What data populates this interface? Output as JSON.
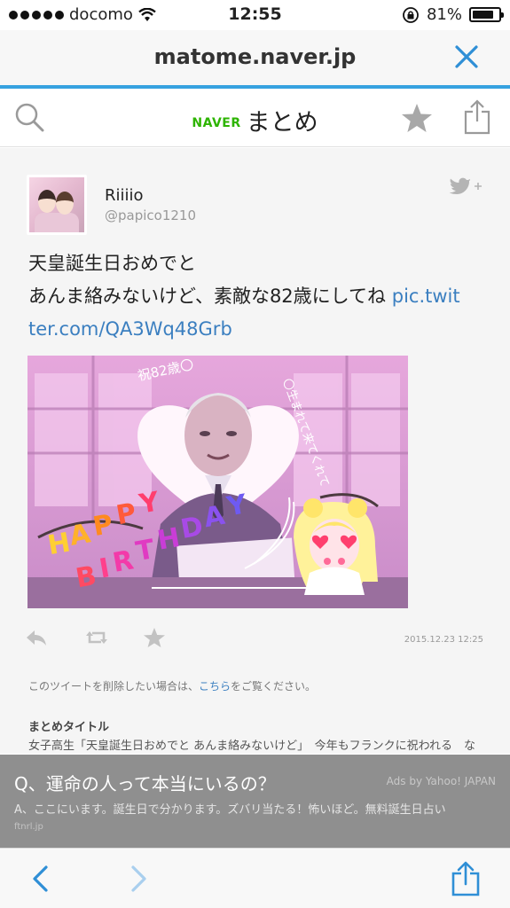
{
  "status_bar": {
    "carrier": "docomo",
    "time": "12:55",
    "battery": "81%",
    "battery_level": 0.81
  },
  "url_bar": {
    "domain": "matome.naver.jp"
  },
  "site_header": {
    "brand": "NAVER",
    "name": "まとめ"
  },
  "tweet": {
    "username": "Riiiio",
    "handle": "@papico1210",
    "line1": "天皇誕生日おめでと",
    "line2": "あんま絡みないけど、素敵な82歳にしてね",
    "link_part1": "pic.twit",
    "link_part2": "ter.com/QA3Wq48Grb",
    "photo_text": "HAPPY BIRTHDAY",
    "timestamp": "2015.12.23 12:25"
  },
  "delete_note": {
    "before": "このツイートを削除したい場合は、",
    "link": "こちら",
    "after": "をご覧ください。"
  },
  "matome": {
    "title_label": "まとめタイトル",
    "title_text": "女子高生「天皇誕生日おめでと あんま絡みないけど」　今年もフランクに祝われる　な"
  },
  "ad": {
    "question": "Q、運命の人って本当にいるの？",
    "by": "Ads by Yahoo! JAPAN",
    "answer": "A、ここにいます。誕生日で分かります。ズバリ当たる！怖いほど。無料誕生日占い",
    "source": "ftnrl.jp"
  },
  "colors": {
    "accent": "#36a2e0",
    "naver_green": "#2db400",
    "link": "#3b7fc0"
  }
}
